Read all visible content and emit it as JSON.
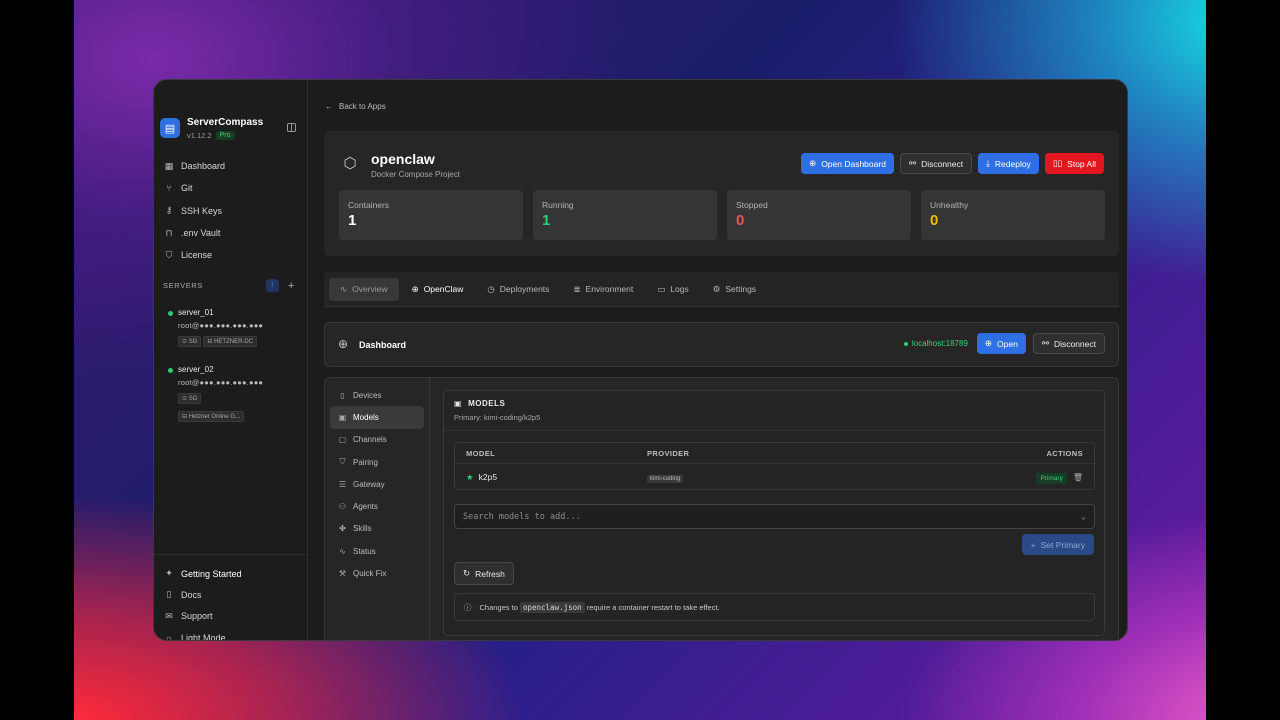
{
  "app": {
    "name": "ServerCompass",
    "version": "v1.12.2",
    "plan": "Pro"
  },
  "sidebar": {
    "items": [
      {
        "label": "Dashboard",
        "icon": "grid-icon"
      },
      {
        "label": "Git",
        "icon": "git-icon"
      },
      {
        "label": "SSH Keys",
        "icon": "key-icon"
      },
      {
        "label": ".env Vault",
        "icon": "lock-icon"
      },
      {
        "label": "License",
        "icon": "shield-icon"
      }
    ],
    "servers_heading": "SERVERS",
    "servers": [
      {
        "name": "server_01",
        "user": "root@●●●.●●●.●●●.●●●",
        "tags": [
          "SG",
          "HETZNER-DC"
        ]
      },
      {
        "name": "server_02",
        "user": "root@●●●.●●●.●●●.●●●",
        "tags": [
          "SG",
          "Hetzner Online G..."
        ]
      }
    ],
    "bottom": [
      {
        "label": "Getting Started",
        "icon": "sparkle-icon"
      },
      {
        "label": "Docs",
        "icon": "book-icon"
      },
      {
        "label": "Support",
        "icon": "mail-icon"
      },
      {
        "label": "Light Mode",
        "icon": "sun-icon"
      }
    ]
  },
  "main": {
    "back_label": "Back to Apps",
    "app_title": "openclaw",
    "app_subtitle": "Docker Compose Project",
    "buttons": {
      "open_dashboard": "Open Dashboard",
      "disconnect": "Disconnect",
      "redeploy": "Redeploy",
      "stop_all": "Stop All"
    },
    "stats": [
      {
        "label": "Containers",
        "value": "1",
        "color": "#ffffff"
      },
      {
        "label": "Running",
        "value": "1",
        "color": "#2ecc71"
      },
      {
        "label": "Stopped",
        "value": "0",
        "color": "#ef5350"
      },
      {
        "label": "Unhealthy",
        "value": "0",
        "color": "#f5b800"
      }
    ],
    "tabs": [
      {
        "label": "Overview",
        "icon": "activity-icon"
      },
      {
        "label": "OpenClaw",
        "icon": "globe-icon"
      },
      {
        "label": "Deployments",
        "icon": "clock-icon"
      },
      {
        "label": "Environment",
        "icon": "database-icon"
      },
      {
        "label": "Logs",
        "icon": "file-icon"
      },
      {
        "label": "Settings",
        "icon": "gear-icon"
      }
    ],
    "dashboard": {
      "title": "Dashboard",
      "address": "localhost:18789",
      "open_label": "Open",
      "disconnect_label": "Disconnect"
    },
    "subnav": [
      {
        "label": "Devices",
        "icon": "device-icon"
      },
      {
        "label": "Models",
        "icon": "chip-icon"
      },
      {
        "label": "Channels",
        "icon": "chat-icon"
      },
      {
        "label": "Pairing",
        "icon": "shield-icon"
      },
      {
        "label": "Gateway",
        "icon": "server-icon"
      },
      {
        "label": "Agents",
        "icon": "users-icon"
      },
      {
        "label": "Skills",
        "icon": "puzzle-icon"
      },
      {
        "label": "Status",
        "icon": "activity-icon"
      },
      {
        "label": "Quick Fix",
        "icon": "wrench-icon"
      }
    ],
    "models": {
      "title": "MODELS",
      "primary_line": "Primary: kimi-coding/k2p5",
      "columns": [
        "MODEL",
        "PROVIDER",
        "ACTIONS"
      ],
      "rows": [
        {
          "model": "k2p5",
          "provider": "kimi-coding",
          "badge": "Primary"
        }
      ],
      "search_placeholder": "Search models to add...",
      "set_primary_label": "Set Primary",
      "refresh_label": "Refresh",
      "note_before": "Changes to",
      "note_code": "openclaw.json",
      "note_after": "require a container restart to take effect."
    }
  },
  "colors": {
    "accent_blue": "#2f6fe6",
    "danger_red": "#e1161f",
    "success_green": "#2ecc71"
  }
}
